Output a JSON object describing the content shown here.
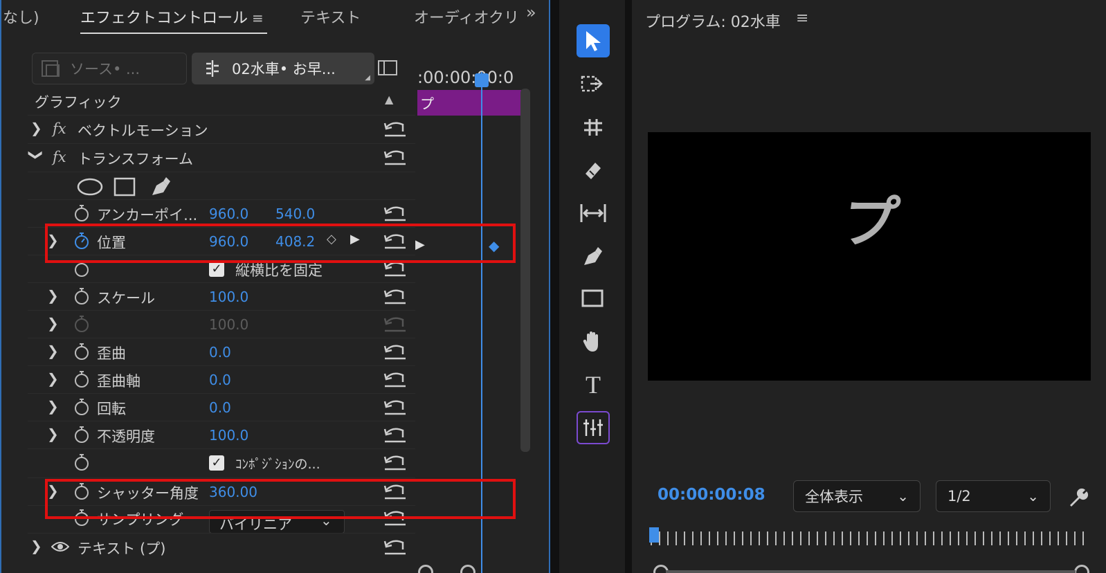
{
  "tabs": {
    "overflow_left": "なし)",
    "effect_controls": "エフェクトコントロール",
    "text": "テキスト",
    "audio_clip": "オーディオクリ",
    "more": "»"
  },
  "effect_controls": {
    "source_btn": "ソース• ...",
    "sequence_btn": "02水車• お早...",
    "section": "グラフィック",
    "timecode_ruler": ":00:00:00:0",
    "clip_label": "プ",
    "effects": {
      "vector_motion": "ベクトルモーション",
      "transform": "トランスフォーム",
      "text_layer": "テキスト (プ)"
    },
    "props": {
      "anchor": {
        "label": "アンカーポイ...",
        "x": "960.0",
        "y": "540.0"
      },
      "position": {
        "label": "位置",
        "x": "960.0",
        "y": "408.2"
      },
      "lock_aspect": {
        "label": "縦横比を固定",
        "checked": true
      },
      "scale": {
        "label": "スケール",
        "value": "100.0"
      },
      "scale_width": {
        "label": "",
        "value": "100.0"
      },
      "skew": {
        "label": "歪曲",
        "value": "0.0"
      },
      "skew_axis": {
        "label": "歪曲軸",
        "value": "0.0"
      },
      "rotation": {
        "label": "回転",
        "value": "0.0"
      },
      "opacity": {
        "label": "不透明度",
        "value": "100.0"
      },
      "comp_shutter": {
        "label": "ｺﾝﾎﾟｼﾞｼｮﾝの...",
        "checked": true
      },
      "shutter_angle": {
        "label": "シャッター角度",
        "value": "360.00"
      },
      "sampling": {
        "label": "サンプリング",
        "value": "バイリニア"
      }
    }
  },
  "program_monitor": {
    "title": "プログラム: 02水車",
    "timecode": "00:00:00:08",
    "fit": "全体表示",
    "resolution": "1/2",
    "frame_text": "プ"
  },
  "colors": {
    "accent": "#3f8ee8",
    "highlight": "#e01010",
    "clip": "#7a1c87"
  }
}
